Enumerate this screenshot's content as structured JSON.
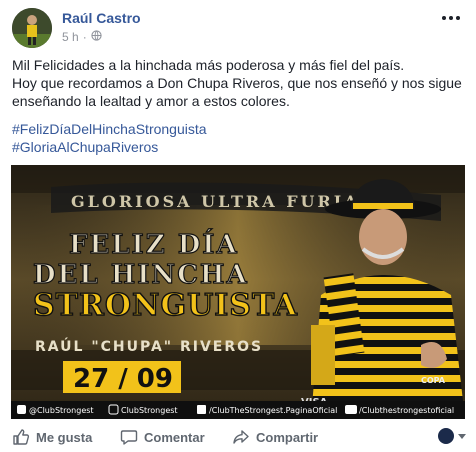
{
  "post": {
    "author": "Raúl Castro",
    "time": "5 h",
    "separator": "·",
    "privacy_icon": "globe-icon",
    "lines": [
      "Mil Felicidades a la hinchada más poderosa y más fiel del país.",
      "Hoy que recordamos a Don Chupa Riveros, que nos enseñó y nos sigue",
      "enseñando la lealtad y amor a estos colores."
    ],
    "hashtags": [
      "#FelizDíaDelHinchaStronguista",
      "#GloriaAlChupaRiveros"
    ]
  },
  "image": {
    "banner_text": "GLORIOSA ULTRA FURIA",
    "line1": "FELIZ DÍA",
    "line2": "DEL HINCHA",
    "line3": "STRONGUISTA",
    "name": "RAÚL \"CHUPA\" RIVEROS",
    "date": "27 / 09",
    "sponsor": "VISA",
    "copa": "COPA",
    "footer": [
      "@ClubStrongest",
      "ClubStrongest",
      "/ClubTheStrongest.PaginaOficial",
      "/Clubthestrongestoficial"
    ],
    "colors": {
      "gold": "#f2c21a",
      "black": "#111111"
    }
  },
  "actions": {
    "like": "Me gusta",
    "comment": "Comentar",
    "share": "Compartir"
  }
}
